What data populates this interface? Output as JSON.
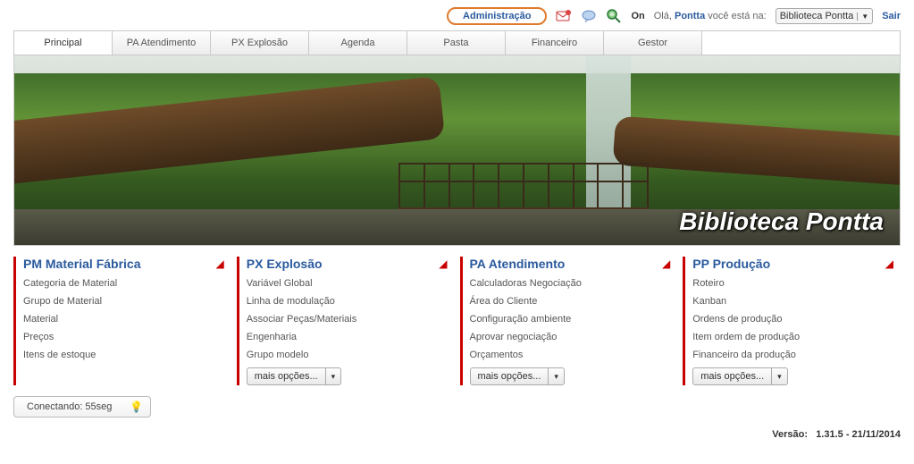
{
  "header": {
    "admin": "Administração",
    "on": "On",
    "greeting_prefix": "Olá,",
    "user": "Pontta",
    "greeting_suffix": "você está na:",
    "library_selected": "Biblioteca Pontta",
    "logout": "Sair",
    "icons": {
      "mail": "mail-icon",
      "chat": "chat-icon",
      "search": "search-icon"
    }
  },
  "tabs": [
    {
      "label": "Principal",
      "active": true
    },
    {
      "label": "PA Atendimento",
      "active": false
    },
    {
      "label": "PX Explosão",
      "active": false
    },
    {
      "label": "Agenda",
      "active": false
    },
    {
      "label": "Pasta",
      "active": false
    },
    {
      "label": "Financeiro",
      "active": false
    },
    {
      "label": "Gestor",
      "active": false
    }
  ],
  "banner": {
    "title": "Biblioteca Pontta"
  },
  "modules": [
    {
      "title": "PM Material Fábrica",
      "links": [
        "Categoria de Material",
        "Grupo de Material",
        "Material",
        "Preços",
        "Itens de estoque"
      ],
      "more": null
    },
    {
      "title": "PX Explosão",
      "links": [
        "Variável Global",
        "Linha de modulação",
        "Associar Peças/Materiais",
        "Engenharia",
        "Grupo modelo"
      ],
      "more": "mais opções..."
    },
    {
      "title": "PA Atendimento",
      "links": [
        "Calculadoras Negociação",
        "Área do Cliente",
        "Configuração ambiente",
        "Aprovar negociação",
        "Orçamentos"
      ],
      "more": "mais opções..."
    },
    {
      "title": "PP Produção",
      "links": [
        "Roteiro",
        "Kanban",
        "Ordens de produção",
        "Item ordem de produção",
        "Financeiro da produção"
      ],
      "more": "mais opções..."
    }
  ],
  "status": {
    "text": "Conectando: 55seg"
  },
  "footer": {
    "label": "Versão:",
    "value": "1.31.5 - 21/11/2014"
  }
}
